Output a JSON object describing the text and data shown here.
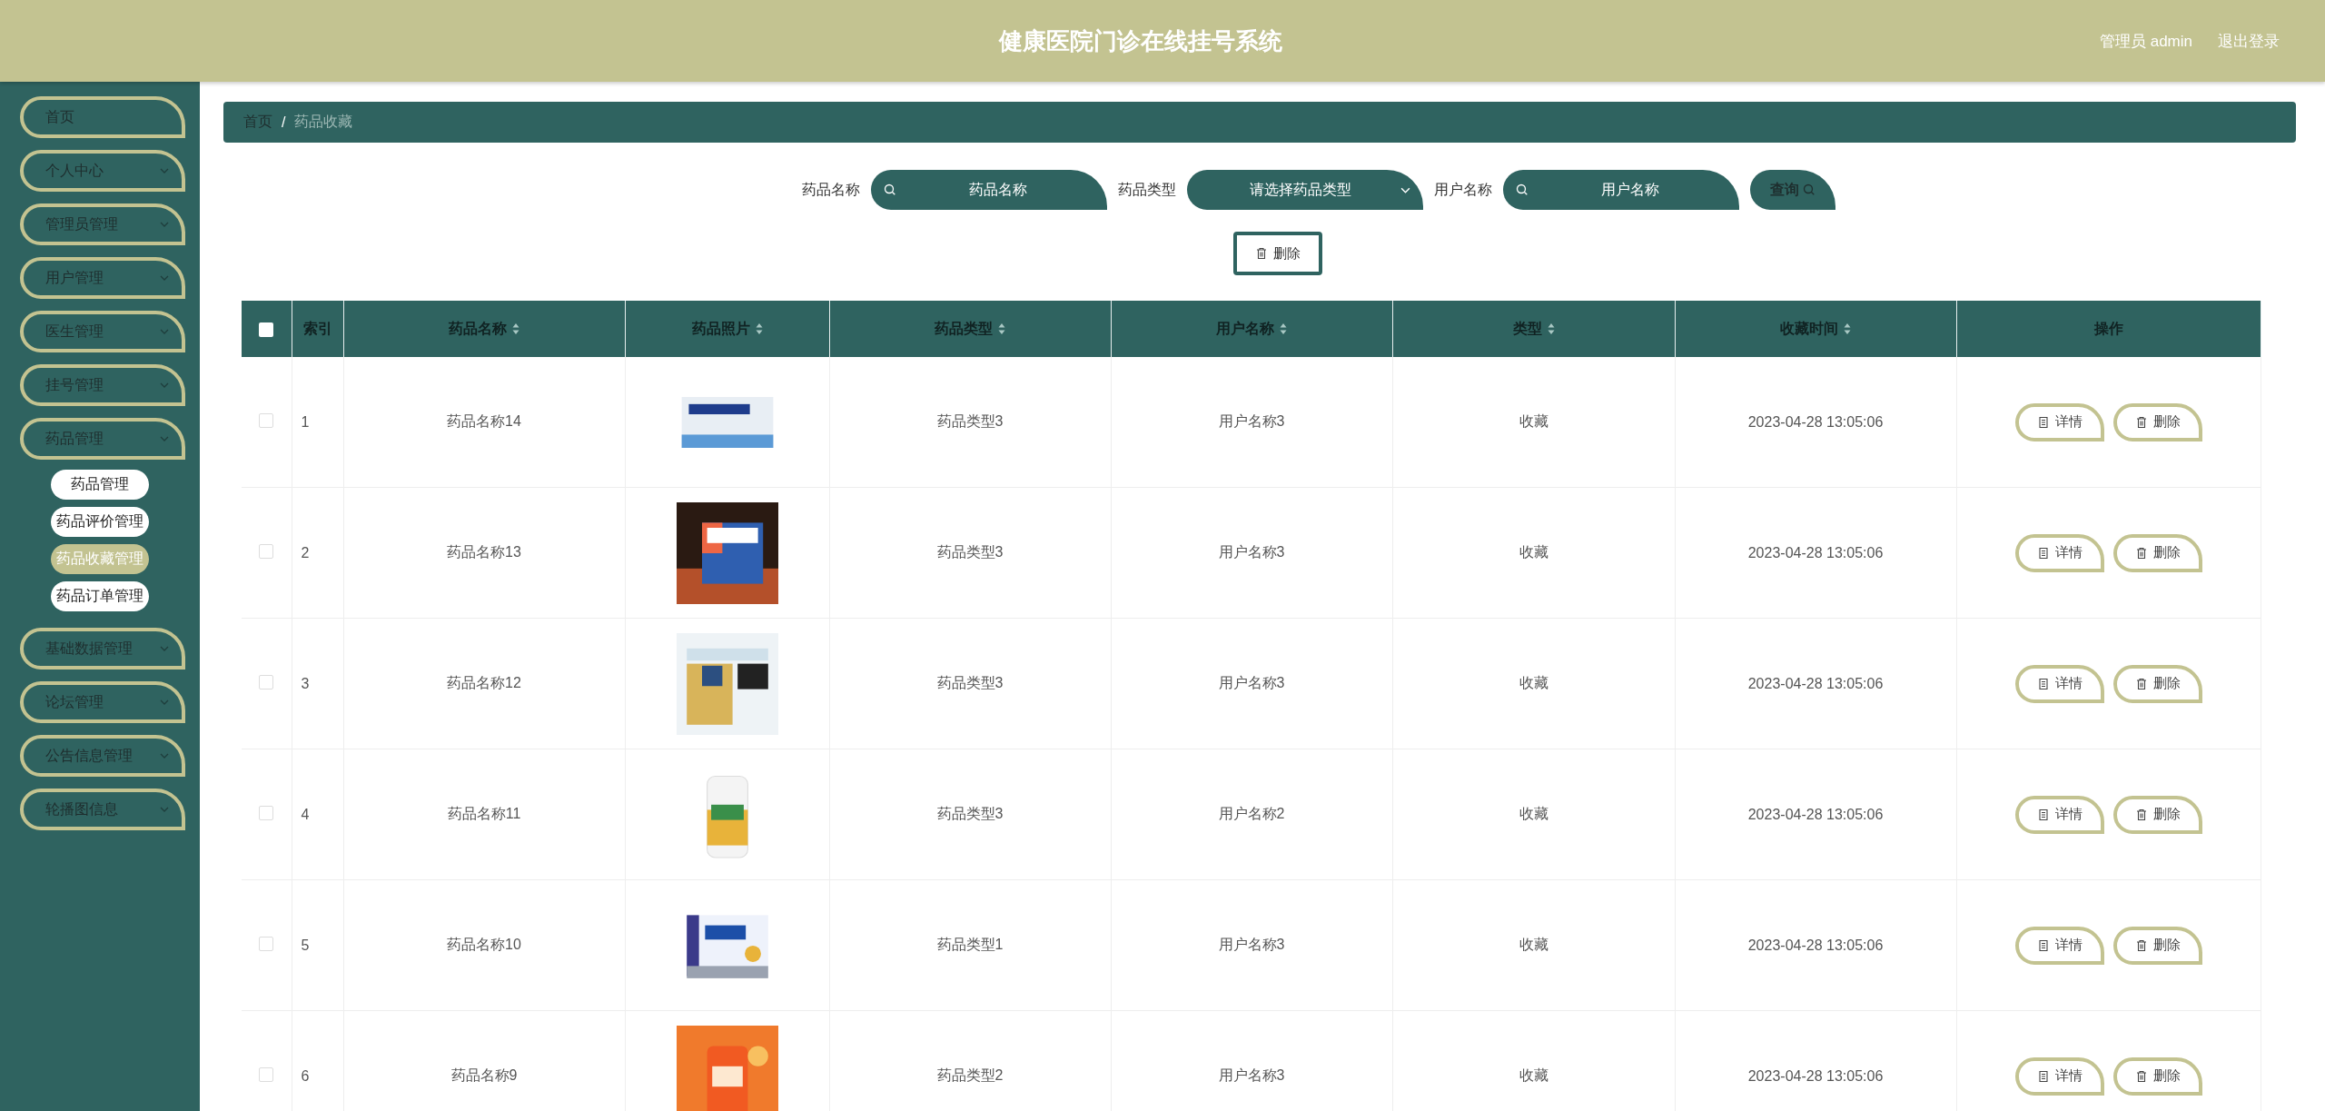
{
  "header": {
    "title": "健康医院门诊在线挂号系统",
    "user": "管理员 admin",
    "logout": "退出登录"
  },
  "sidebar": {
    "items": [
      {
        "label": "首页",
        "expandable": false
      },
      {
        "label": "个人中心",
        "expandable": true,
        "expanded": false
      },
      {
        "label": "管理员管理",
        "expandable": true,
        "expanded": false
      },
      {
        "label": "用户管理",
        "expandable": true,
        "expanded": false
      },
      {
        "label": "医生管理",
        "expandable": true,
        "expanded": false
      },
      {
        "label": "挂号管理",
        "expandable": true,
        "expanded": false
      },
      {
        "label": "药品管理",
        "expandable": true,
        "expanded": true,
        "children": [
          {
            "label": "药品管理",
            "selected": false
          },
          {
            "label": "药品评价管理",
            "selected": false
          },
          {
            "label": "药品收藏管理",
            "selected": true
          },
          {
            "label": "药品订单管理",
            "selected": false
          }
        ]
      },
      {
        "label": "基础数据管理",
        "expandable": true,
        "expanded": false
      },
      {
        "label": "论坛管理",
        "expandable": true,
        "expanded": false
      },
      {
        "label": "公告信息管理",
        "expandable": true,
        "expanded": false
      },
      {
        "label": "轮播图信息",
        "expandable": true,
        "expanded": false
      }
    ]
  },
  "breadcrumb": {
    "items": [
      "首页",
      "药品收藏"
    ],
    "separator": "/"
  },
  "search": {
    "fields": [
      {
        "kind": "input",
        "label": "药品名称",
        "placeholder": "药品名称"
      },
      {
        "kind": "select",
        "label": "药品类型",
        "placeholder": "请选择药品类型"
      },
      {
        "kind": "input",
        "label": "用户名称",
        "placeholder": "用户名称"
      }
    ],
    "query_button": "查询"
  },
  "delete_button": "删除",
  "table": {
    "select_all_checked": false,
    "columns": [
      {
        "label": "索引",
        "sortable": false
      },
      {
        "label": "药品名称",
        "sortable": true
      },
      {
        "label": "药品照片",
        "sortable": true
      },
      {
        "label": "药品类型",
        "sortable": true
      },
      {
        "label": "用户名称",
        "sortable": true
      },
      {
        "label": "类型",
        "sortable": true
      },
      {
        "label": "收藏时间",
        "sortable": true
      },
      {
        "label": "操作",
        "sortable": false
      }
    ],
    "rows": [
      {
        "checked": false,
        "index": "1",
        "name": "药品名称14",
        "photo": {
          "kind": "picture"
        },
        "type": "药品类型3",
        "user": "用户名称3",
        "kind": "收藏",
        "time": "2023-04-28 13:05:06",
        "actions": [
          "详情",
          "删除"
        ]
      },
      {
        "checked": false,
        "index": "2",
        "name": "药品名称13",
        "photo": {
          "kind": "picture"
        },
        "type": "药品类型3",
        "user": "用户名称3",
        "kind": "收藏",
        "time": "2023-04-28 13:05:06",
        "actions": [
          "详情",
          "删除"
        ]
      },
      {
        "checked": false,
        "index": "3",
        "name": "药品名称12",
        "photo": {
          "kind": "picture"
        },
        "type": "药品类型3",
        "user": "用户名称3",
        "kind": "收藏",
        "time": "2023-04-28 13:05:06",
        "actions": [
          "详情",
          "删除"
        ]
      },
      {
        "checked": false,
        "index": "4",
        "name": "药品名称11",
        "photo": {
          "kind": "picture"
        },
        "type": "药品类型3",
        "user": "用户名称2",
        "kind": "收藏",
        "time": "2023-04-28 13:05:06",
        "actions": [
          "详情",
          "删除"
        ]
      },
      {
        "checked": false,
        "index": "5",
        "name": "药品名称10",
        "photo": {
          "kind": "picture"
        },
        "type": "药品类型1",
        "user": "用户名称3",
        "kind": "收藏",
        "time": "2023-04-28 13:05:06",
        "actions": [
          "详情",
          "删除"
        ]
      },
      {
        "checked": false,
        "index": "6",
        "name": "药品名称9",
        "photo": {
          "kind": "picture"
        },
        "type": "药品类型2",
        "user": "用户名称3",
        "kind": "收藏",
        "time": "2023-04-28 13:05:06",
        "actions": [
          "详情",
          "删除"
        ]
      }
    ]
  }
}
